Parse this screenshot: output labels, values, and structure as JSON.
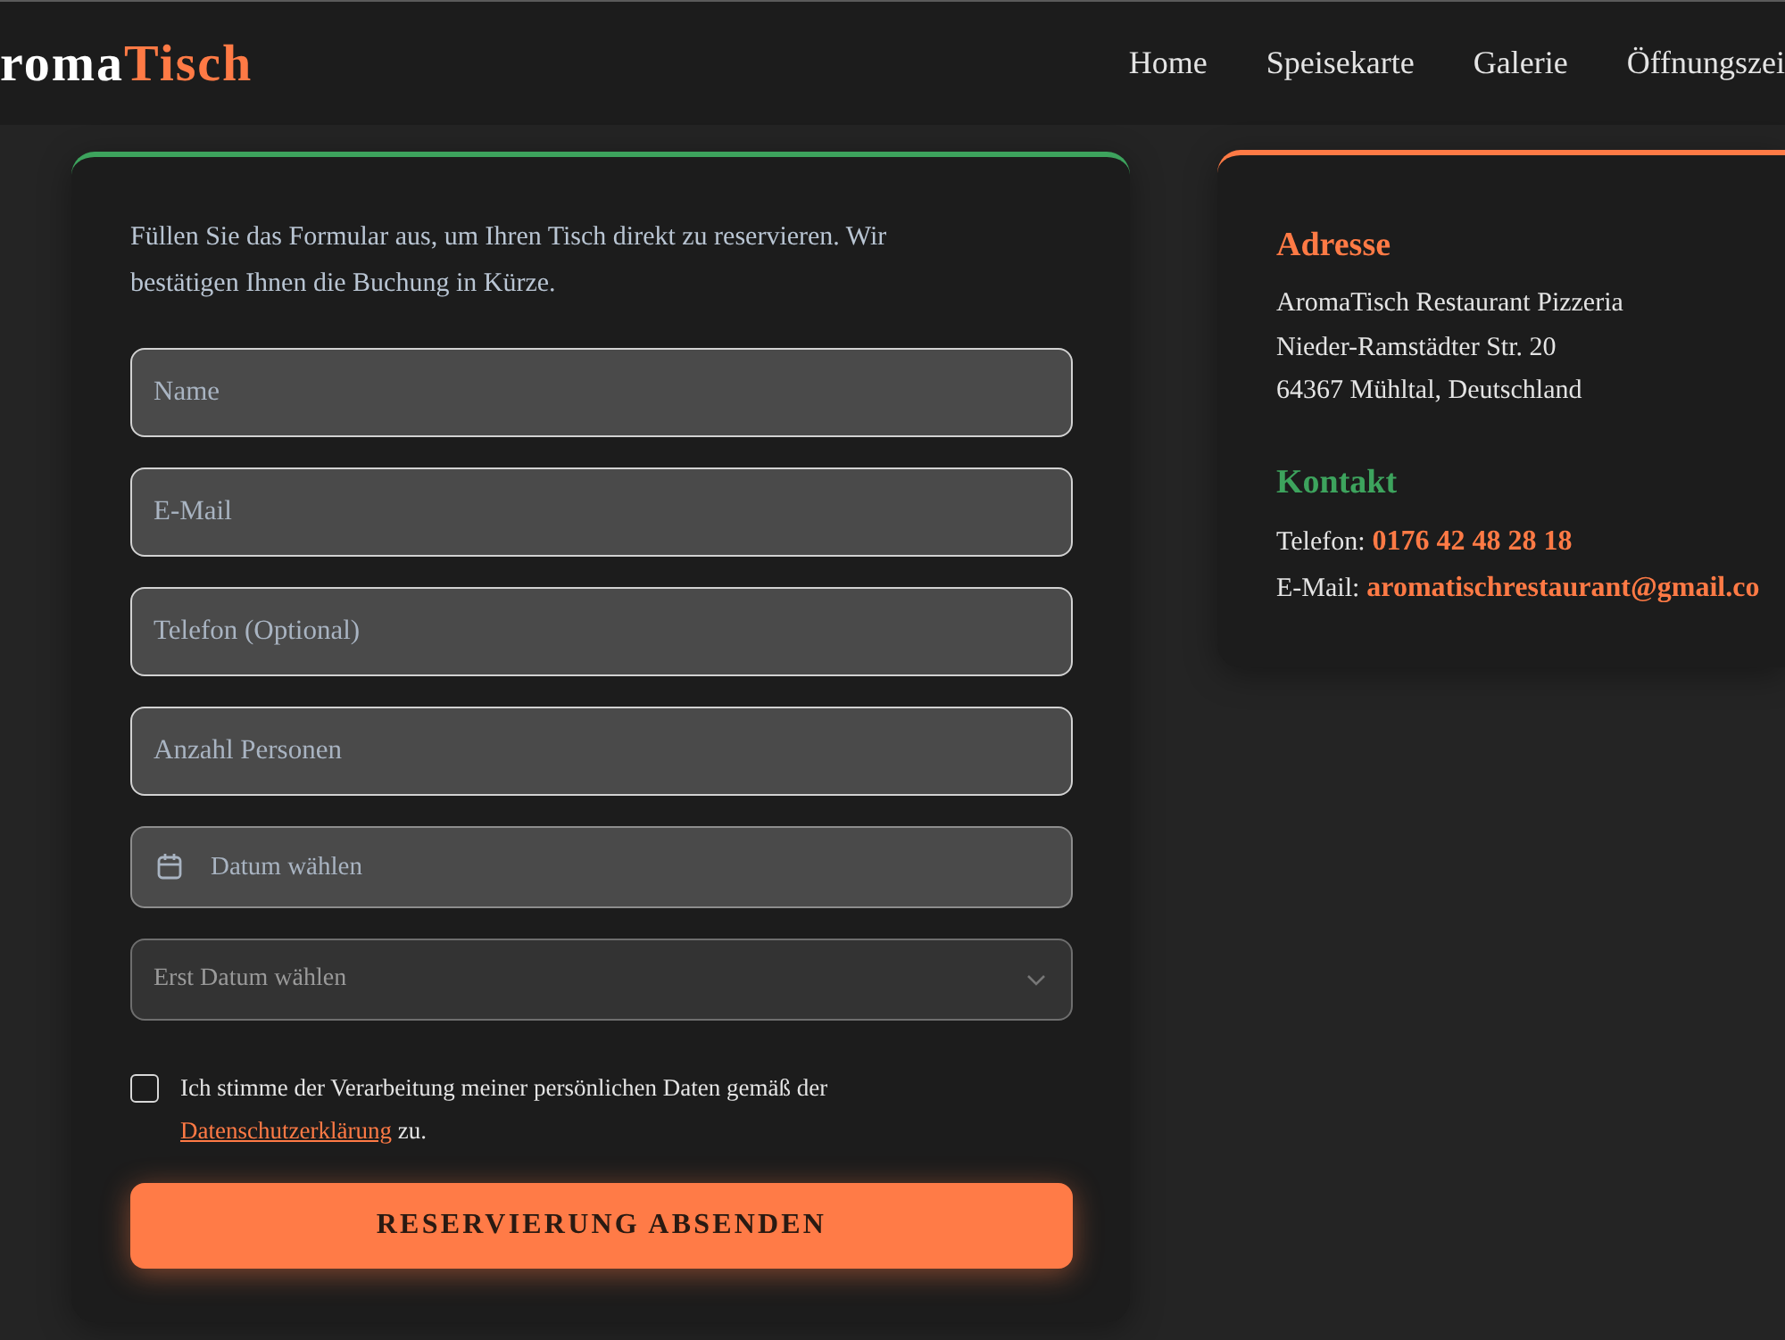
{
  "header": {
    "logo": {
      "part_1": "roma",
      "part_2": "Tisch"
    },
    "nav": [
      {
        "label": "Home"
      },
      {
        "label": "Speisekarte"
      },
      {
        "label": "Galerie"
      },
      {
        "label": "Öffnungszei"
      }
    ]
  },
  "reservation_form": {
    "intro": "Füllen Sie das Formular aus, um Ihren Tisch direkt zu reservieren. Wir bestätigen Ihnen die Buchung in Kürze.",
    "fields": [
      {
        "kind": "text",
        "placeholder": "Name"
      },
      {
        "kind": "text",
        "placeholder": "E-Mail"
      },
      {
        "kind": "text",
        "placeholder": "Telefon (Optional)"
      },
      {
        "kind": "text",
        "placeholder": "Anzahl Personen"
      },
      {
        "kind": "date",
        "placeholder": "Datum wählen"
      },
      {
        "kind": "select",
        "placeholder": "Erst Datum wählen",
        "disabled": true
      }
    ],
    "consent": {
      "checked": false,
      "text_before": "Ich stimme der Verarbeitung meiner persönlichen Daten gemäß der",
      "link": "Datenschutzerklärung",
      "text_after": "zu."
    },
    "submit": "RESERVIERUNG ABSENDEN"
  },
  "info_card": {
    "address": {
      "heading": "Adresse",
      "lines": [
        "AromaTisch Restaurant Pizzeria",
        "Nieder-Ramstädter Str. 20",
        "64367 Mühltal, Deutschland"
      ]
    },
    "contact": {
      "heading": "Kontakt",
      "items": [
        {
          "label": "Telefon:",
          "value": "0176 42 48 28 18"
        },
        {
          "label": "E-Mail:",
          "value": "aromatischrestaurant@gmail.co"
        }
      ]
    }
  }
}
